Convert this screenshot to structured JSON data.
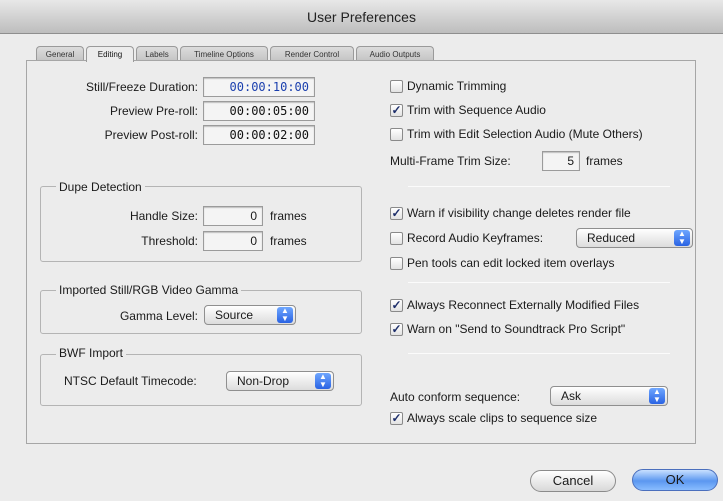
{
  "window": {
    "title": "User Preferences"
  },
  "tabs": [
    "General",
    "Editing",
    "Labels",
    "Timeline Options",
    "Render Control",
    "Audio Outputs"
  ],
  "active_tab": "Editing",
  "left": {
    "still_label": "Still/Freeze Duration:",
    "still_value": "00:00:10:00",
    "preroll_label": "Preview Pre-roll:",
    "preroll_value": "00:00:05:00",
    "postroll_label": "Preview Post-roll:",
    "postroll_value": "00:00:02:00"
  },
  "dupe": {
    "title": "Dupe Detection",
    "handle_label": "Handle Size:",
    "handle_value": "0",
    "handle_unit": "frames",
    "threshold_label": "Threshold:",
    "threshold_value": "0",
    "threshold_unit": "frames"
  },
  "gamma": {
    "title": "Imported Still/RGB Video Gamma",
    "label": "Gamma Level:",
    "value": "Source"
  },
  "bwf": {
    "title": "BWF Import",
    "label": "NTSC Default Timecode:",
    "value": "Non-Drop"
  },
  "right": {
    "dynamic_trimming": {
      "label": "Dynamic Trimming",
      "checked": false
    },
    "trim_seq_audio": {
      "label": "Trim with Sequence Audio",
      "checked": true
    },
    "trim_edit_sel": {
      "label": "Trim with Edit Selection Audio (Mute Others)",
      "checked": false
    },
    "multi_trim_label": "Multi-Frame Trim Size:",
    "multi_trim_value": "5",
    "multi_trim_unit": "frames",
    "warn_visibility": {
      "label": "Warn if visibility change deletes render file",
      "checked": true
    },
    "record_keyframes": {
      "label": "Record Audio Keyframes:",
      "checked": false
    },
    "record_keyframes_value": "Reduced",
    "pen_tools": {
      "label": "Pen tools can edit locked item overlays",
      "checked": false
    },
    "always_reconnect": {
      "label": "Always Reconnect Externally Modified Files",
      "checked": true
    },
    "warn_soundtrack": {
      "label": "Warn on \"Send to Soundtrack Pro Script\"",
      "checked": true
    },
    "auto_conform_label": "Auto conform sequence:",
    "auto_conform_value": "Ask",
    "always_scale": {
      "label": "Always scale clips to sequence size",
      "checked": true
    }
  },
  "buttons": {
    "cancel": "Cancel",
    "ok": "OK"
  }
}
